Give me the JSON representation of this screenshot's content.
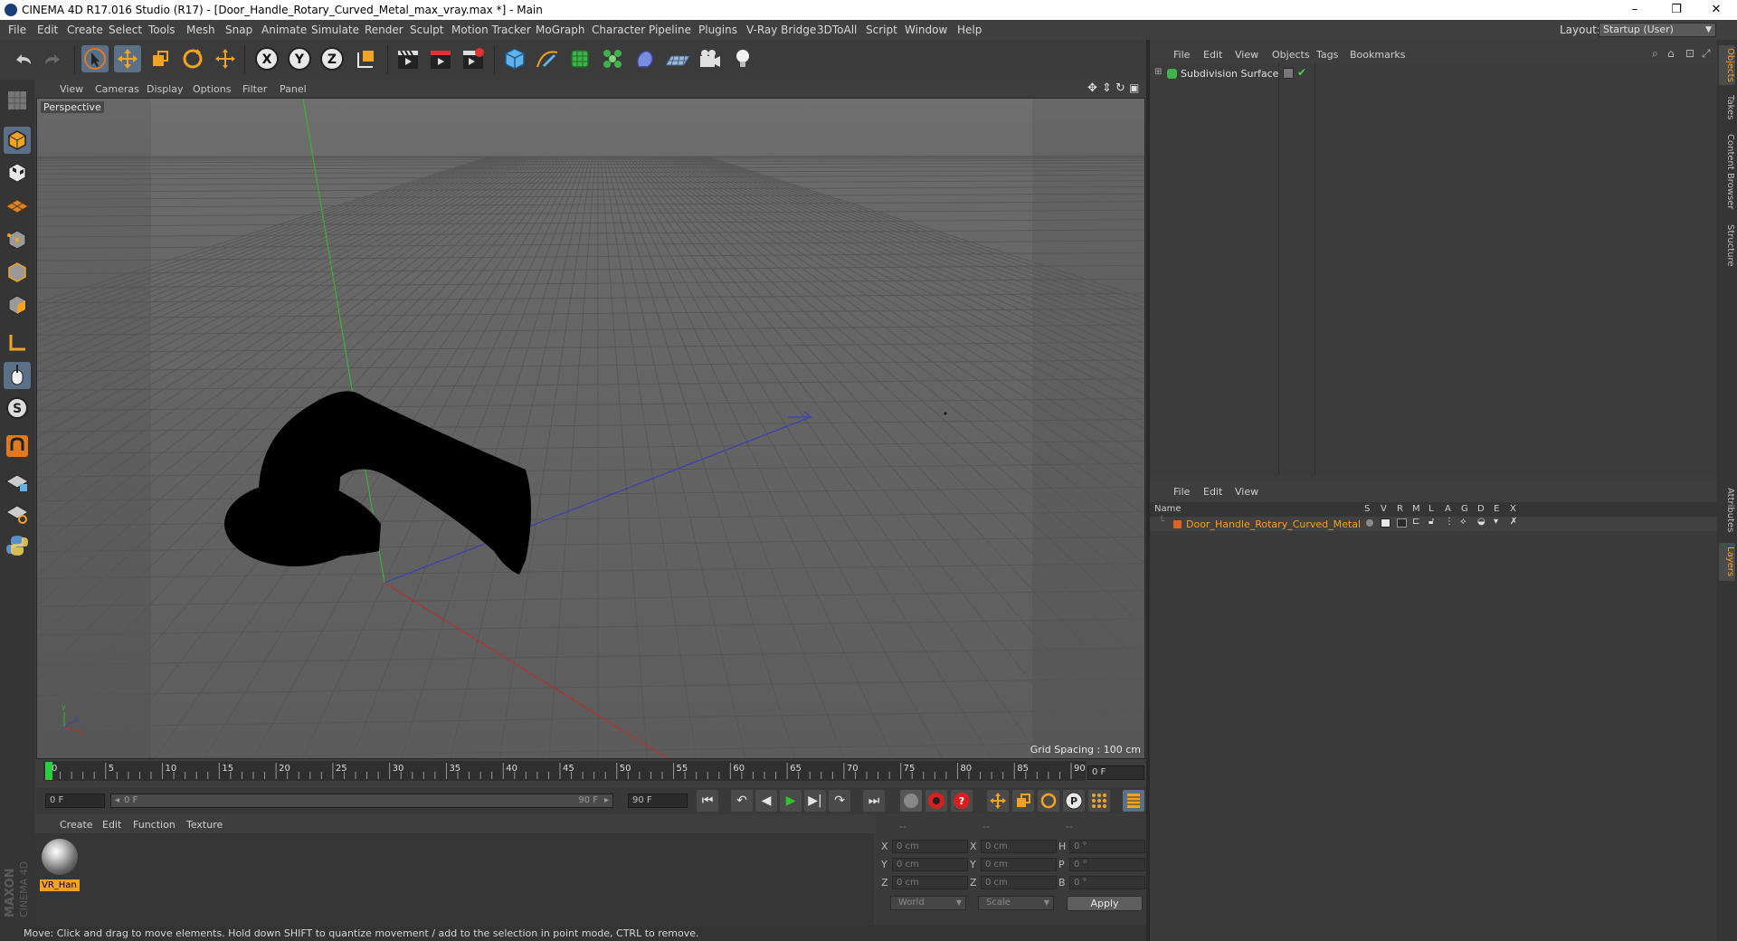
{
  "window": {
    "title": "CINEMA 4D R17.016 Studio (R17) - [Door_Handle_Rotary_Curved_Metal_max_vray.max *] - Main",
    "controls": [
      "–",
      "❐",
      "✕"
    ]
  },
  "menubar": {
    "items": [
      "File",
      "Edit",
      "Create",
      "Select",
      "Tools",
      "Mesh",
      "Snap",
      "Animate",
      "Simulate",
      "Render",
      "Sculpt",
      "Motion Tracker",
      "MoGraph",
      "Character",
      "Pipeline",
      "Plugins",
      "V-Ray Bridge",
      "3DToAll",
      "Script",
      "Window",
      "Help"
    ],
    "layout_label": "Layout:",
    "layout_value": "Startup (User)"
  },
  "toolbar": {
    "icons": [
      "undo-icon",
      "redo-icon",
      "select-pointer-icon",
      "move-icon",
      "scale-icon",
      "rotate-icon",
      "transform-icon",
      "x-axis-lock-icon",
      "y-axis-lock-icon",
      "z-axis-lock-icon",
      "world-coordinates-icon",
      "render-view-icon",
      "render-picture-viewer-icon",
      "edit-render-settings-icon",
      "cube-primitive-icon",
      "pen-spline-icon",
      "subdivision-icon",
      "mograph-cloner-icon",
      "deformer-icon",
      "floor-icon",
      "camera-icon",
      "light-icon"
    ],
    "xyz": [
      "X",
      "Y",
      "Z"
    ]
  },
  "viewport": {
    "menu": [
      "View",
      "Cameras",
      "Display",
      "Options",
      "Filter",
      "Panel"
    ],
    "label": "Perspective",
    "grid_spacing": "Grid Spacing : 100 cm",
    "colors": {
      "bg_top": "#6b6b6b",
      "bg_bottom": "#5a5a5a",
      "grid": "#555555",
      "x_axis": "#b4322e",
      "y_axis": "#3fae3a",
      "z_axis": "#3b3fb5",
      "object": "#000000"
    }
  },
  "timeline": {
    "ticks": [
      "0",
      "5",
      "10",
      "15",
      "20",
      "25",
      "30",
      "35",
      "40",
      "45",
      "50",
      "55",
      "60",
      "65",
      "70",
      "75",
      "80",
      "85",
      "90"
    ],
    "current_frame": "0 F",
    "start_field": "0 F",
    "range_start": "0 F",
    "range_end": "90 F",
    "end_field": "90 F",
    "playhead_frame": 0,
    "max_frame": 90,
    "transport_glyphs": [
      "⏮",
      "↶",
      "◀",
      "▶",
      "▶|",
      "↷",
      "⏭"
    ]
  },
  "material_manager": {
    "menu": [
      "Create",
      "Edit",
      "Function",
      "Texture"
    ],
    "materials": [
      {
        "label": "VR_Han"
      }
    ]
  },
  "coordinates": {
    "headers": [
      "--",
      "--",
      "--"
    ],
    "rows": [
      {
        "axis": "X",
        "pos": "0 cm",
        "axis2": "X",
        "size": "0 cm",
        "rot_label": "H",
        "rot": "0 °"
      },
      {
        "axis": "Y",
        "pos": "0 cm",
        "axis2": "Y",
        "size": "0 cm",
        "rot_label": "P",
        "rot": "0 °"
      },
      {
        "axis": "Z",
        "pos": "0 cm",
        "axis2": "Z",
        "size": "0 cm",
        "rot_label": "B",
        "rot": "0 °"
      }
    ],
    "mode_world": "World",
    "mode_scale": "Scale",
    "apply": "Apply"
  },
  "status": "Move: Click and drag to move elements. Hold down SHIFT to quantize movement / add to the selection in point mode, CTRL to remove.",
  "object_manager": {
    "menu": [
      "File",
      "Edit",
      "View",
      "Objects",
      "Tags",
      "Bookmarks"
    ],
    "objects": [
      {
        "name": "Subdivision Surface"
      }
    ]
  },
  "layer_manager": {
    "menu": [
      "File",
      "Edit",
      "View"
    ],
    "columns": [
      "Name",
      "S",
      "V",
      "R",
      "M",
      "L",
      "A",
      "G",
      "D",
      "E",
      "X"
    ],
    "layers": [
      {
        "name": "Door_Handle_Rotary_Curved_Metal",
        "color": "#e2621f"
      }
    ]
  },
  "side_tabs": [
    "Objects",
    "Takes",
    "Content Browser",
    "Structure",
    "Attributes",
    "Layers"
  ],
  "branding": {
    "line1": "MAXON",
    "line2": "CINEMA 4D"
  }
}
